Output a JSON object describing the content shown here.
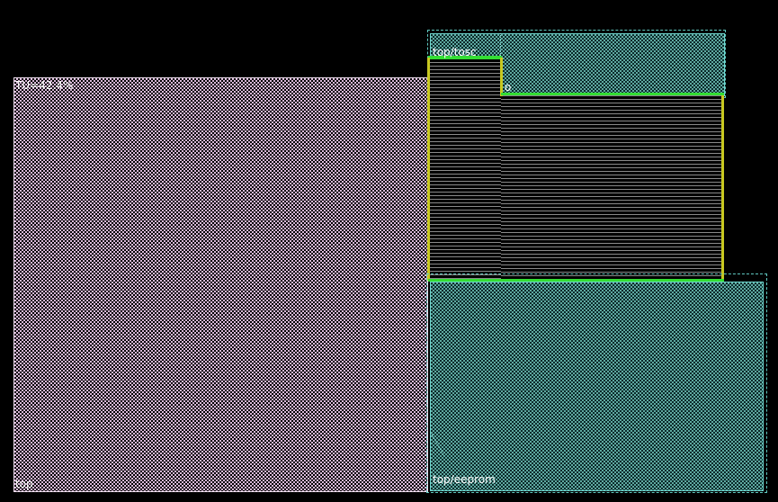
{
  "layout_view": {
    "top_block": {
      "name": "top",
      "utilization_label": "TU=42.4%"
    },
    "osc_block": {
      "name": "top/tosc",
      "pin_label": "o"
    },
    "eeprom_block": {
      "name": "top/eeprom"
    }
  },
  "colors": {
    "background": "#000000",
    "top_fill": "#d8b8d8",
    "macro_fill": "#5fa8a0",
    "halo_green": "#33dd33",
    "edge_yellow": "#c8c820",
    "outline_teal": "#5fc8c0"
  }
}
